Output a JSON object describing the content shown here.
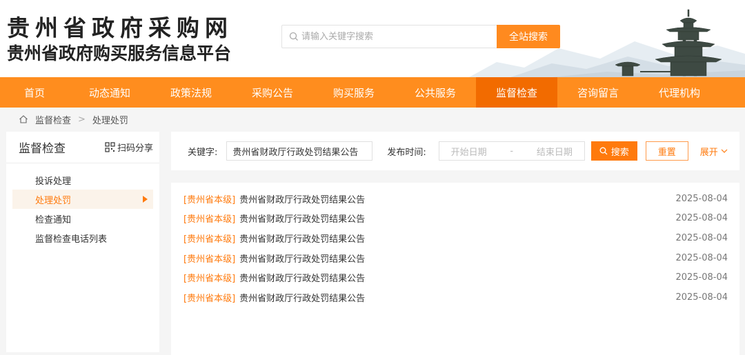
{
  "header": {
    "logo_line1": "贵州省政府采购网",
    "logo_line2": "贵州省政府购买服务信息平台",
    "search_placeholder": "请输入关键字搜索",
    "search_button": "全站搜索"
  },
  "nav": [
    "首页",
    "动态通知",
    "政策法规",
    "采购公告",
    "购买服务",
    "公共服务",
    "监督检查",
    "咨询留言",
    "代理机构"
  ],
  "nav_active": "监督检查",
  "breadcrumb": {
    "level1": "监督检查",
    "separator": ">",
    "level2": "处理处罚"
  },
  "sidebar": {
    "title": "监督检查",
    "share": "扫码分享",
    "items": [
      {
        "label": "投诉处理"
      },
      {
        "label": "处理处罚"
      },
      {
        "label": "检查通知"
      },
      {
        "label": "监督检查电话列表"
      }
    ],
    "active": "处理处罚"
  },
  "filter": {
    "keyword_label": "关键字:",
    "keyword_value": "贵州省财政厅行政处罚结果公告",
    "date_label": "发布时间:",
    "start_placeholder": "开始日期",
    "dash": "-",
    "end_placeholder": "结束日期",
    "search_button": "搜索",
    "reset_button": "重置",
    "expand": "展开"
  },
  "results": [
    {
      "tag": "[贵州省本级]",
      "title": "贵州省财政厅行政处罚结果公告",
      "date": "2025-08-04"
    },
    {
      "tag": "[贵州省本级]",
      "title": "贵州省财政厅行政处罚结果公告",
      "date": "2025-08-04"
    },
    {
      "tag": "[贵州省本级]",
      "title": "贵州省财政厅行政处罚结果公告",
      "date": "2025-08-04"
    },
    {
      "tag": "[贵州省本级]",
      "title": "贵州省财政厅行政处罚结果公告",
      "date": "2025-08-04"
    },
    {
      "tag": "[贵州省本级]",
      "title": "贵州省财政厅行政处罚结果公告",
      "date": "2025-08-04"
    },
    {
      "tag": "[贵州省本级]",
      "title": "贵州省财政厅行政处罚结果公告",
      "date": "2025-08-04"
    }
  ],
  "colors": {
    "accent": "#ff8d1e",
    "active_nav": "#f26b00",
    "link_orange": "#ff7a0d"
  }
}
